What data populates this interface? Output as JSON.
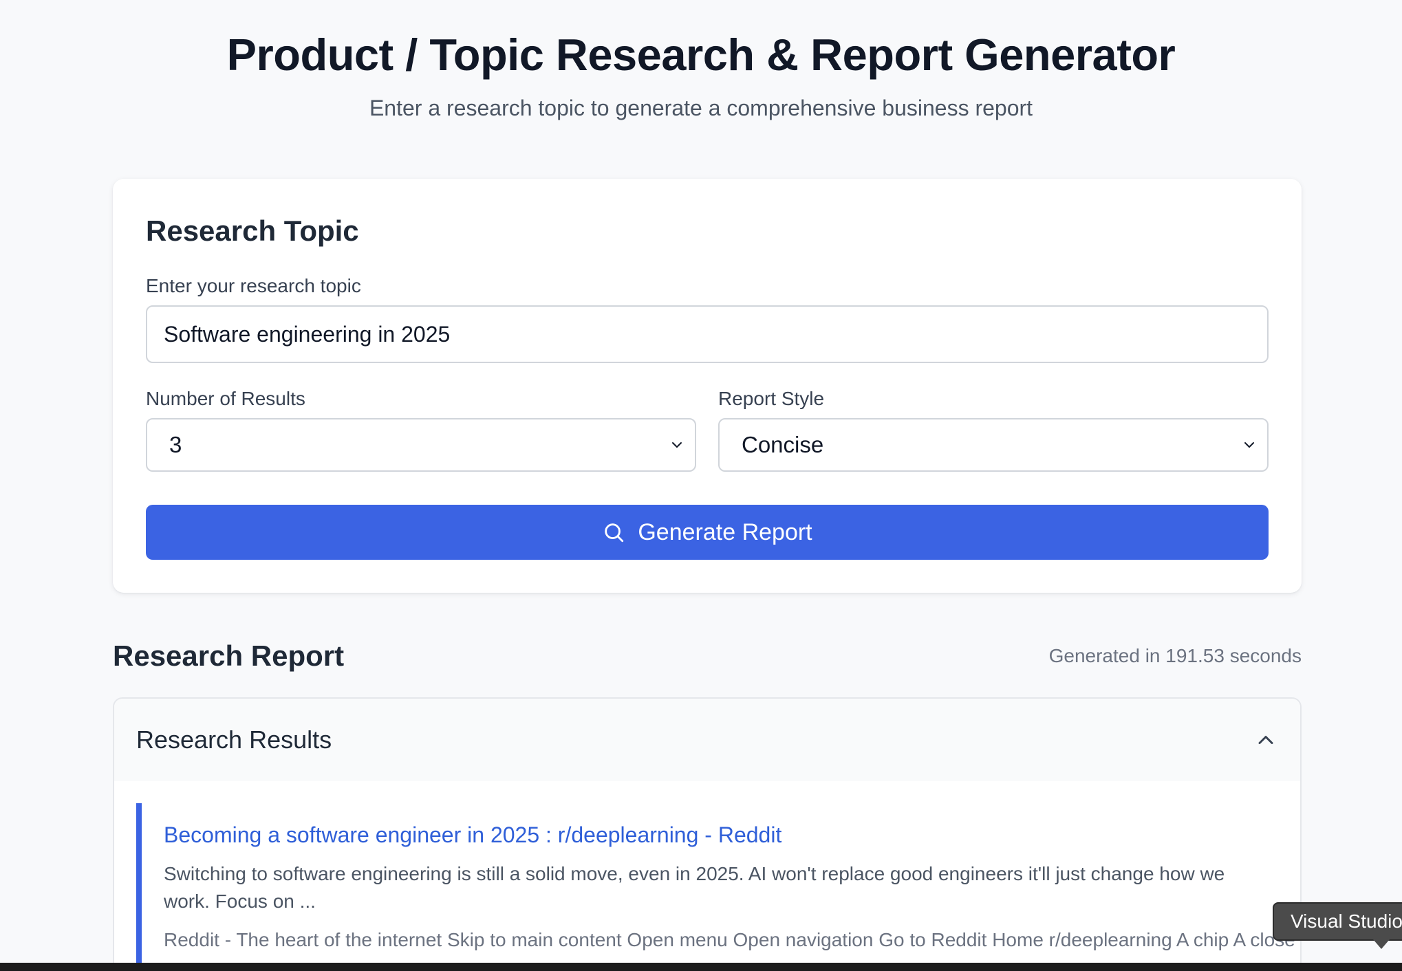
{
  "header": {
    "title": "Product / Topic Research & Report Generator",
    "subtitle": "Enter a research topic to generate a comprehensive business report"
  },
  "form": {
    "card_title": "Research Topic",
    "topic_label": "Enter your research topic",
    "topic_value": "Software engineering in 2025",
    "num_results_label": "Number of Results",
    "num_results_value": "3",
    "report_style_label": "Report Style",
    "report_style_value": "Concise",
    "generate_label": "Generate Report"
  },
  "report": {
    "title": "Research Report",
    "generated_time": "Generated in 191.53 seconds"
  },
  "results": {
    "title": "Research Results",
    "items": [
      {
        "title": "Becoming a software engineer in 2025 : r/deeplearning - Reddit",
        "snippet": "Switching to software engineering is still a solid move, even in 2025. AI won't replace good engineers it'll just change how we work. Focus on ...",
        "content": "Reddit - The heart of the internet Skip to main content Open menu Open navigation Go to Reddit Home r/deeplearning A chip A close button Log In Log in to Reddit Expand user menu Open settings menu Go to deeplearning r/deeplearning"
      }
    ]
  },
  "tooltip": {
    "text": "Visual Studio Code"
  },
  "colors": {
    "accent": "#3b63e3",
    "link": "#2f5fd8"
  },
  "icons": {
    "generate": "search-icon",
    "select": "chevron-down-icon",
    "collapse": "chevron-up-icon"
  }
}
